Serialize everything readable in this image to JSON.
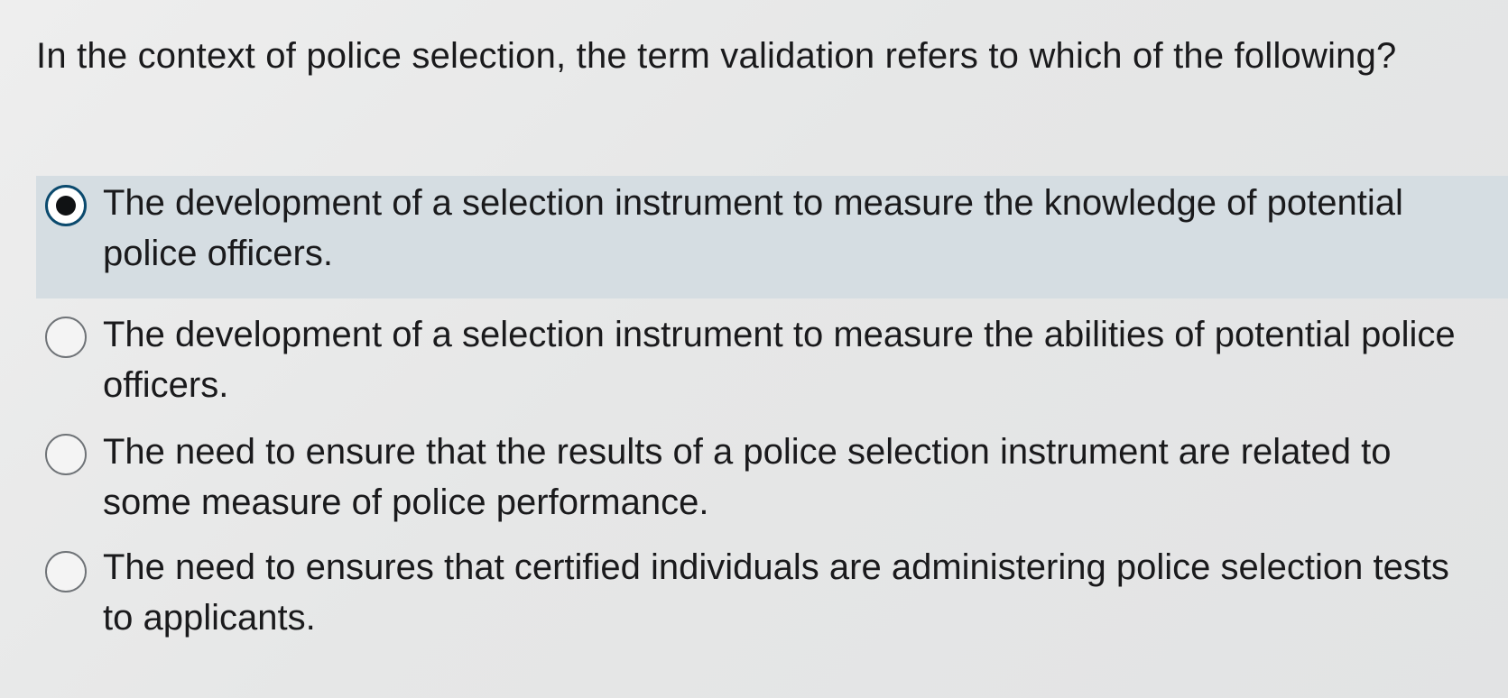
{
  "question": {
    "text": "In the context of police selection, the term validation refers to which of the following?"
  },
  "options": [
    {
      "label": "The development of a selection instrument to measure the knowledge of potential police officers.",
      "selected": true
    },
    {
      "label": "The development of a selection instrument to measure the abilities of potential police officers.",
      "selected": false
    },
    {
      "label": "The need to ensure that the results of a police selection instrument are related to some measure of police performance.",
      "selected": false
    },
    {
      "label": "The need to ensures that certified individuals are administering police selection tests to applicants.",
      "selected": false
    }
  ],
  "colors": {
    "selected_highlight": "#d5dde2",
    "radio_selected_border": "#0b4a6e",
    "text": "#1a1a1c"
  }
}
